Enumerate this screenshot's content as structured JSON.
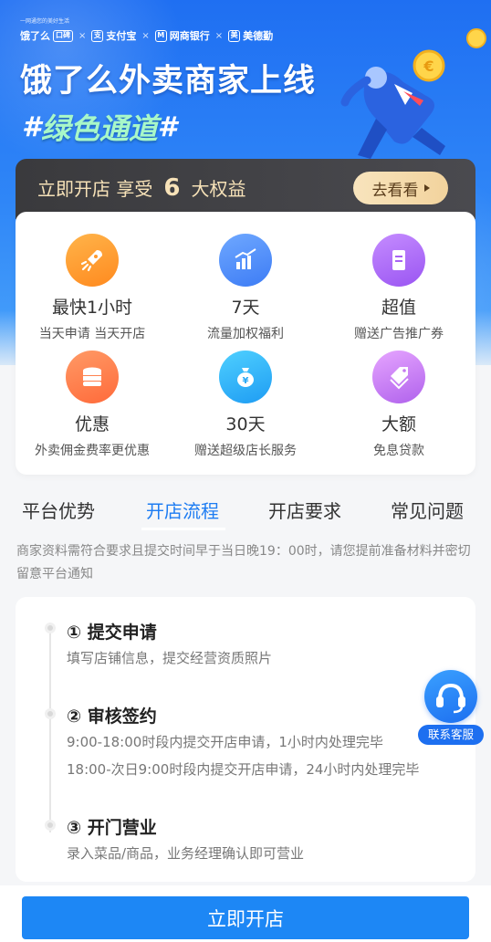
{
  "hero": {
    "slogan": "一网通您的美好生活",
    "partners": [
      {
        "name": "饿了么",
        "badge": "口碑"
      },
      {
        "name": "支付宝"
      },
      {
        "name": "网商银行"
      },
      {
        "name": "美德勤"
      }
    ],
    "separator": "×",
    "title": "饿了么外卖商家上线",
    "subtitle_hash_left": "#",
    "subtitle_main": "绿色通道",
    "subtitle_hash_right": "#"
  },
  "promo": {
    "text_before": "立即开店 享受",
    "number": "6",
    "text_after": "大权益",
    "button_label": "去看看"
  },
  "benefits": [
    {
      "title": "最快1小时",
      "desc": "当天申请 当天开店",
      "icon": "rocket-icon",
      "color": "#ff9a2e"
    },
    {
      "title": "7天",
      "desc": "流量加权福利",
      "icon": "bar-chart-icon",
      "color": "#4f8ef8"
    },
    {
      "title": "超值",
      "desc": "赠送广告推广券",
      "icon": "coupon-icon",
      "color": "#a862f4"
    },
    {
      "title": "优惠",
      "desc": "外卖佣金费率更优惠",
      "icon": "coin-stack-icon",
      "color": "#ff7a45"
    },
    {
      "title": "30天",
      "desc": "赠送超级店长服务",
      "icon": "money-bag-icon",
      "color": "#28a8f5"
    },
    {
      "title": "大额",
      "desc": "免息贷款",
      "icon": "tag-icon",
      "color": "#c47bef"
    }
  ],
  "tabs": [
    {
      "label": "平台优势"
    },
    {
      "label": "开店流程",
      "active": true
    },
    {
      "label": "开店要求"
    },
    {
      "label": "常见问题"
    }
  ],
  "notice": "商家资料需符合要求且提交时间早于当日晚19：00时，请您提前准备材料并密切留意平台通知",
  "steps": [
    {
      "title": "① 提交申请",
      "desc": [
        "填写店铺信息，提交经营资质照片"
      ]
    },
    {
      "title": "② 审核签约",
      "desc": [
        "9:00-18:00时段内提交开店申请，1小时内处理完毕",
        "18:00-次日9:00时段内提交开店申请，24小时内处理完毕"
      ]
    },
    {
      "title": "③ 开门营业",
      "desc": [
        "录入菜品/商品，业务经理确认即可营业"
      ]
    }
  ],
  "service": {
    "label": "联系客服",
    "icon": "headset-icon"
  },
  "bottom": {
    "button_label": "立即开店"
  },
  "colors": {
    "primary": "#1d87f5",
    "hero": "#1f6ff2",
    "gold": "#f7e2b8"
  }
}
